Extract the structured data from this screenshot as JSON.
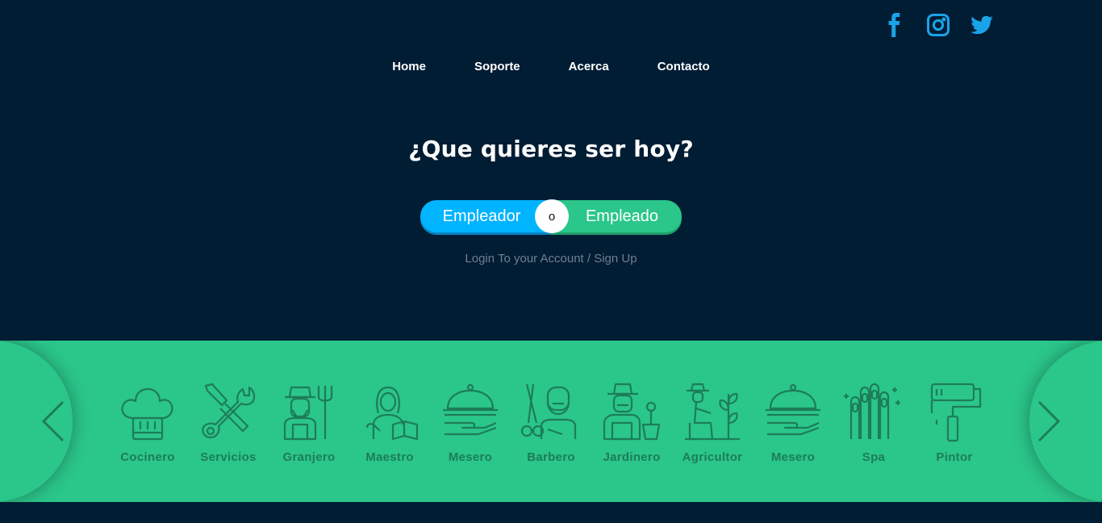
{
  "social": [
    {
      "name": "facebook-icon",
      "color": "#1aa3e8"
    },
    {
      "name": "instagram-icon",
      "color": "#1aa3e8"
    },
    {
      "name": "twitter-icon",
      "color": "#1aa3e8"
    }
  ],
  "nav": {
    "items": [
      "Home",
      "Soporte",
      "Acerca",
      "Contacto"
    ]
  },
  "hero": {
    "title": "¿Que quieres ser hoy?",
    "employer": "Empleador",
    "or": "o",
    "employee": "Empleado",
    "login": "Login To your Account / Sign Up"
  },
  "colors": {
    "background": "#001d34",
    "accent_blue": "#00b4ff",
    "accent_green": "#2bc68a",
    "icon_green": "#1d7d57"
  },
  "jobs": [
    {
      "label": "Cocinero",
      "icon": "chef-hat-icon"
    },
    {
      "label": "Servicios",
      "icon": "tools-icon"
    },
    {
      "label": "Granjero",
      "icon": "farmer-icon"
    },
    {
      "label": "Maestro",
      "icon": "teacher-icon"
    },
    {
      "label": "Mesero",
      "icon": "cloche-icon"
    },
    {
      "label": "Barbero",
      "icon": "barber-icon"
    },
    {
      "label": "Jardinero",
      "icon": "gardener-icon"
    },
    {
      "label": "Agricultor",
      "icon": "agriculture-icon"
    },
    {
      "label": "Mesero",
      "icon": "cloche-icon"
    },
    {
      "label": "Spa",
      "icon": "nails-icon"
    },
    {
      "label": "Pintor",
      "icon": "paint-roller-icon"
    }
  ]
}
